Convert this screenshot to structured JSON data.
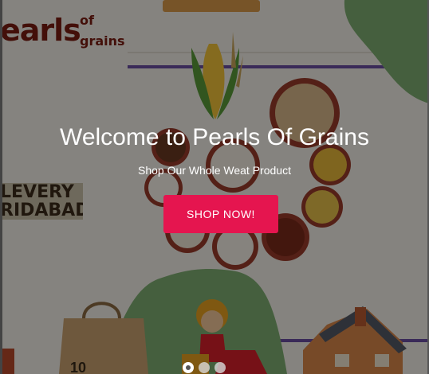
{
  "hero": {
    "logo": {
      "main": "earls",
      "of": "of",
      "grains": "grains"
    },
    "delivery_sign": {
      "line1": "LEVERY",
      "line2": "RIDABAD"
    },
    "title": "Welcome to Pearls Of Grains",
    "subtitle": "Shop Our Whole Weat Product",
    "cta_label": "SHOP NOW!"
  },
  "carousel": {
    "slide_count": 3,
    "active_index": 0
  },
  "colors": {
    "cta": "#e5154f",
    "logo": "#7a1d12",
    "accent_line": "#6b4ea0",
    "green": "#7fae72"
  },
  "icons": [
    "corn-icon",
    "grain-bowl-icon",
    "shopping-bag-icon",
    "delivery-rider-icon",
    "house-icon"
  ]
}
